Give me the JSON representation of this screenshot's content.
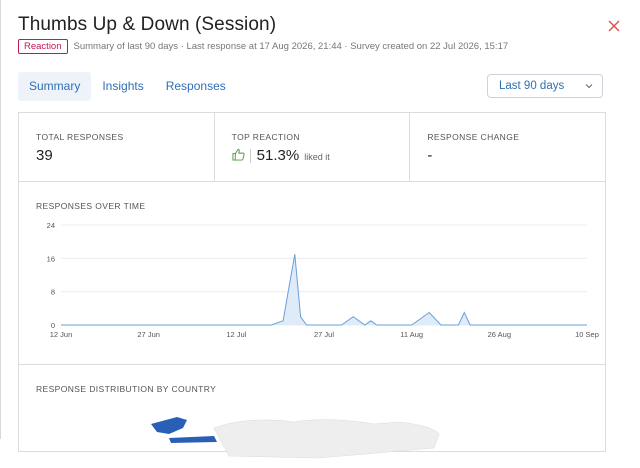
{
  "header": {
    "title": "Thumbs Up & Down (Session)",
    "badge": "Reaction",
    "meta": "Summary of last 90 days · Last response at 17 Aug 2026, 21:44 · Survey created on 22 Jul 2026, 15:17"
  },
  "tabs": [
    {
      "label": "Summary",
      "active": true
    },
    {
      "label": "Insights",
      "active": false
    },
    {
      "label": "Responses",
      "active": false
    }
  ],
  "range_select": {
    "value": "Last 90 days"
  },
  "stats": {
    "total_label": "TOTAL RESPONSES",
    "total_value": "39",
    "top_label": "TOP REACTION",
    "top_value": "51.3%",
    "top_suffix": "liked it",
    "change_label": "RESPONSE CHANGE",
    "change_value": "-"
  },
  "sections": {
    "over_time": "RESPONSES OVER TIME",
    "by_country": "RESPONSE DISTRIBUTION BY COUNTRY"
  },
  "colors": {
    "accent": "#2f6fb5",
    "badge": "#c2185b",
    "line": "#6a9fd8",
    "fill": "#dce9f7",
    "positive": "#4a9a3a",
    "close": "#d9534f"
  },
  "icons": {
    "close": "close-icon",
    "chevron": "chevron-down-icon",
    "reaction": "thumbs-up-icon"
  },
  "chart_data": {
    "type": "area",
    "title": "RESPONSES OVER TIME",
    "x_ticks": [
      "12 Jun",
      "27 Jun",
      "12 Jul",
      "27 Jul",
      "11 Aug",
      "26 Aug",
      "10 Sep"
    ],
    "y_ticks": [
      0,
      8,
      16,
      24
    ],
    "ylim": [
      0,
      24
    ],
    "grid": true,
    "series": [
      {
        "x": [
          "2026-06-12",
          "2026-07-18",
          "2026-07-20",
          "2026-07-21",
          "2026-07-22",
          "2026-07-23",
          "2026-07-24",
          "2026-07-25",
          "2026-07-30",
          "2026-08-01",
          "2026-08-03",
          "2026-08-04",
          "2026-08-05",
          "2026-08-11",
          "2026-08-14",
          "2026-08-16",
          "2026-08-19",
          "2026-08-20",
          "2026-08-21",
          "2026-09-10"
        ],
        "y": [
          0,
          0,
          1,
          9,
          17,
          2,
          0,
          0,
          0,
          2,
          0,
          1,
          0,
          0,
          3,
          0,
          0,
          3,
          0,
          0
        ]
      }
    ]
  }
}
